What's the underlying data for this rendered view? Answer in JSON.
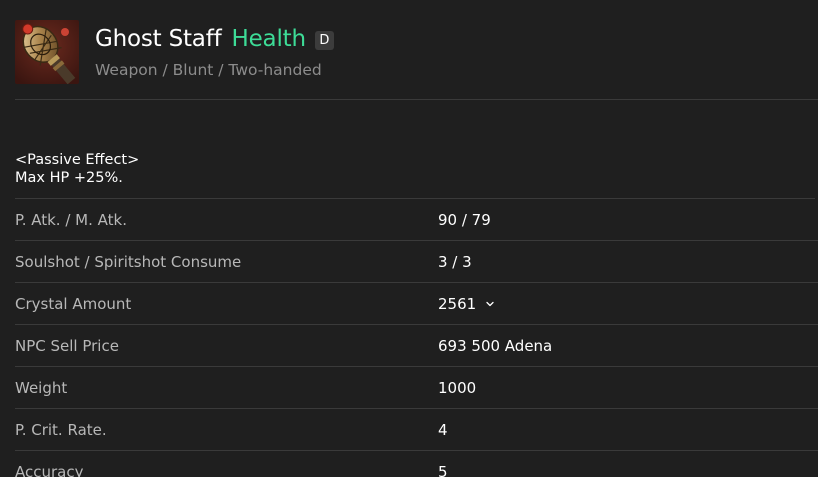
{
  "item": {
    "name": "Ghost Staff",
    "suffix": "Health",
    "grade": "D",
    "category": "Weapon / Blunt / Two-handed",
    "icon": "ghost-staff-icon",
    "colors": {
      "suffix": "#3ddc97",
      "background": "#1f1f1f",
      "label": "#b8b8b8",
      "muted": "#8c8c8c"
    }
  },
  "effect": {
    "title": "<Passive Effect>",
    "text": "Max HP +25%."
  },
  "stats": [
    {
      "label": "P. Atk. / M. Atk.",
      "value": "90 / 79"
    },
    {
      "label": "Soulshot / Spiritshot Consume",
      "value": "3 / 3"
    },
    {
      "label": "Crystal Amount",
      "value": "2561"
    },
    {
      "label": "NPC Sell Price",
      "value": "693 500 Adena"
    },
    {
      "label": "Weight",
      "value": "1000"
    },
    {
      "label": "P. Crit. Rate.",
      "value": "4"
    },
    {
      "label": "Accuracy",
      "value": "5"
    }
  ]
}
